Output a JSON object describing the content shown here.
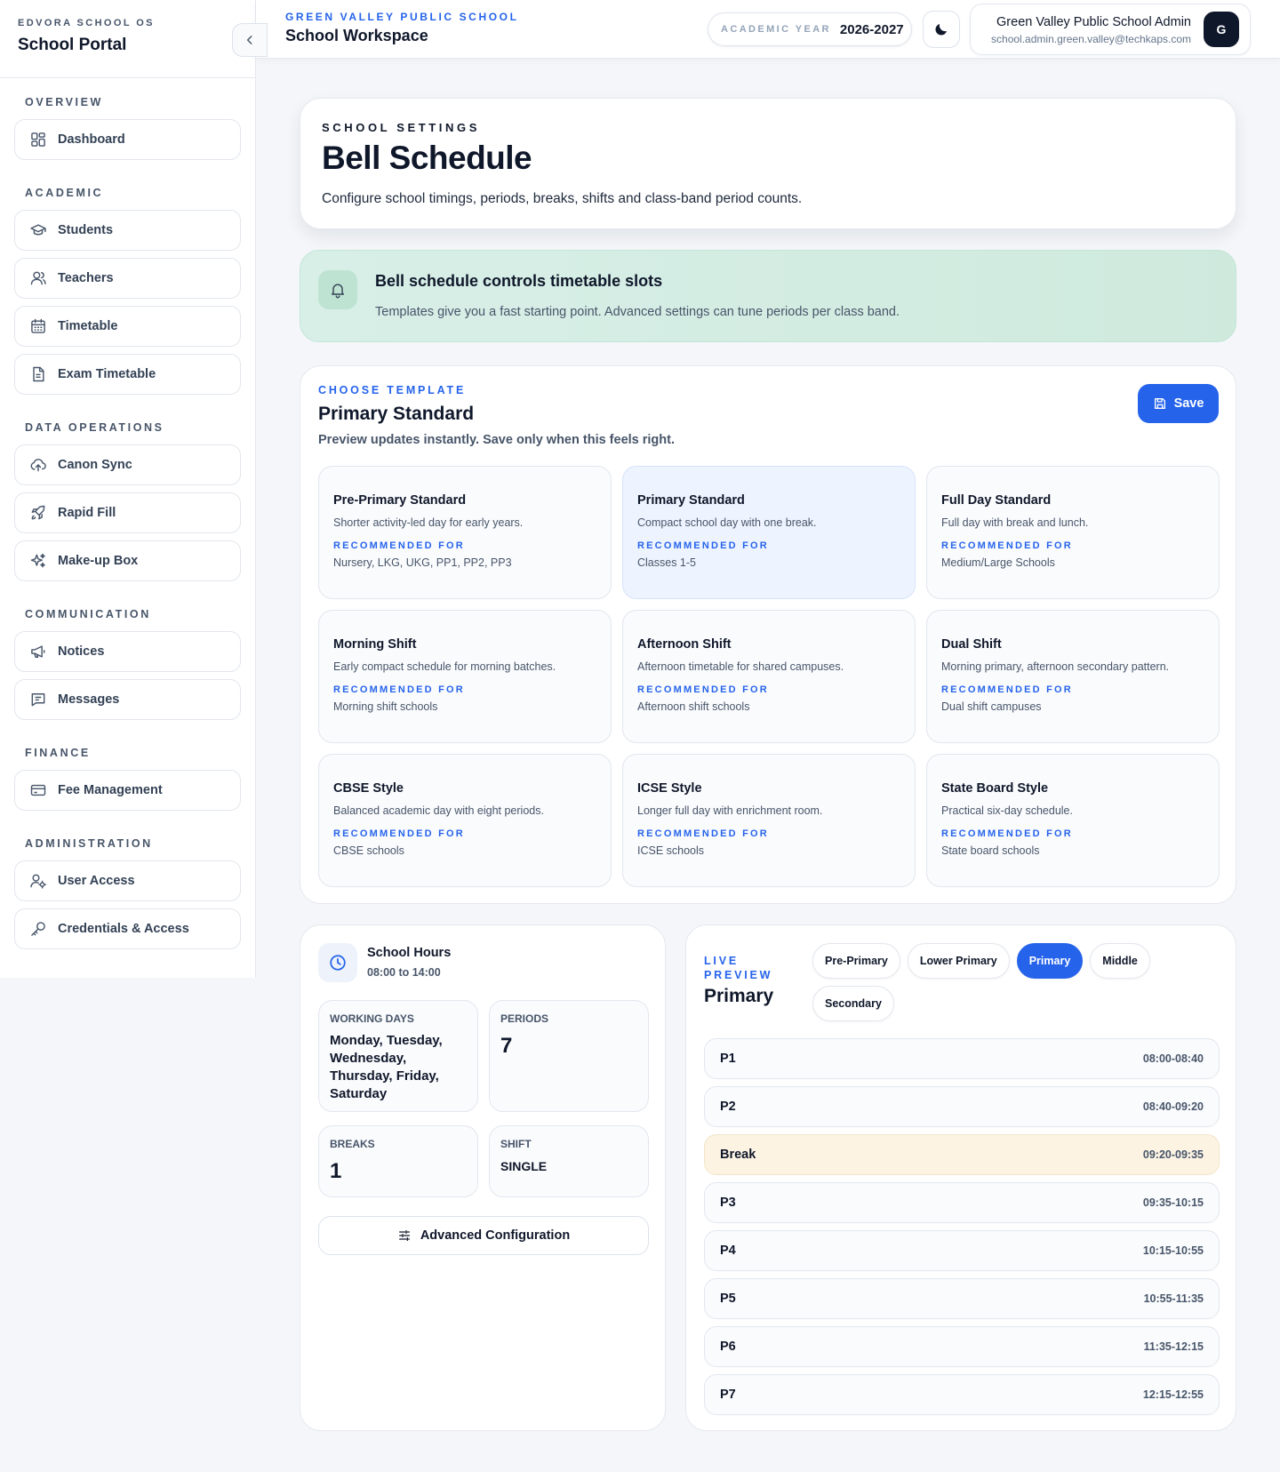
{
  "sidebar": {
    "kicker": "EDVORA SCHOOL OS",
    "title": "School Portal",
    "sections": [
      {
        "label": "OVERVIEW",
        "items": [
          {
            "label": "Dashboard",
            "icon": "dashboard-icon"
          }
        ]
      },
      {
        "label": "ACADEMIC",
        "items": [
          {
            "label": "Students",
            "icon": "graduation-cap-icon"
          },
          {
            "label": "Teachers",
            "icon": "users-icon"
          },
          {
            "label": "Timetable",
            "icon": "calendar-icon"
          },
          {
            "label": "Exam Timetable",
            "icon": "document-icon"
          }
        ]
      },
      {
        "label": "DATA OPERATIONS",
        "items": [
          {
            "label": "Canon Sync",
            "icon": "cloud-upload-icon"
          },
          {
            "label": "Rapid Fill",
            "icon": "rocket-icon"
          },
          {
            "label": "Make-up Box",
            "icon": "sparkles-icon"
          }
        ]
      },
      {
        "label": "COMMUNICATION",
        "items": [
          {
            "label": "Notices",
            "icon": "megaphone-icon"
          },
          {
            "label": "Messages",
            "icon": "message-icon"
          }
        ]
      },
      {
        "label": "FINANCE",
        "items": [
          {
            "label": "Fee Management",
            "icon": "card-icon"
          }
        ]
      },
      {
        "label": "ADMINISTRATION",
        "items": [
          {
            "label": "User Access",
            "icon": "user-gear-icon"
          },
          {
            "label": "Credentials & Access",
            "icon": "key-icon"
          }
        ]
      }
    ]
  },
  "topbar": {
    "kicker": "GREEN VALLEY PUBLIC SCHOOL",
    "title": "School Workspace",
    "year_label": "ACADEMIC YEAR",
    "year_value": "2026-2027",
    "user_name": "Green Valley Public School Admin",
    "user_email": "school.admin.green.valley@techkaps.com",
    "avatar_letter": "G"
  },
  "header": {
    "kicker": "SCHOOL SETTINGS",
    "title": "Bell Schedule",
    "subtitle": "Configure school timings, periods, breaks, shifts and class-band period counts."
  },
  "banner": {
    "title": "Bell schedule controls timetable slots",
    "subtitle": "Templates give you a fast starting point. Advanced settings can tune periods per class band."
  },
  "templates": {
    "kicker": "CHOOSE TEMPLATE",
    "title": "Primary Standard",
    "subtitle": "Preview updates instantly. Save only when this feels right.",
    "save_label": "Save",
    "rec_label": "RECOMMENDED FOR",
    "selected_index": 1,
    "items": [
      {
        "name": "Pre-Primary Standard",
        "desc": "Shorter activity-led day for early years.",
        "for": "Nursery, LKG, UKG, PP1, PP2, PP3"
      },
      {
        "name": "Primary Standard",
        "desc": "Compact school day with one break.",
        "for": "Classes 1-5"
      },
      {
        "name": "Full Day Standard",
        "desc": "Full day with break and lunch.",
        "for": "Medium/Large Schools"
      },
      {
        "name": "Morning Shift",
        "desc": "Early compact schedule for morning batches.",
        "for": "Morning shift schools"
      },
      {
        "name": "Afternoon Shift",
        "desc": "Afternoon timetable for shared campuses.",
        "for": "Afternoon shift schools"
      },
      {
        "name": "Dual Shift",
        "desc": "Morning primary, afternoon secondary pattern.",
        "for": "Dual shift campuses"
      },
      {
        "name": "CBSE Style",
        "desc": "Balanced academic day with eight periods.",
        "for": "CBSE schools"
      },
      {
        "name": "ICSE Style",
        "desc": "Longer full day with enrichment room.",
        "for": "ICSE schools"
      },
      {
        "name": "State Board Style",
        "desc": "Practical six-day schedule.",
        "for": "State board schools"
      }
    ]
  },
  "hours": {
    "title": "School Hours",
    "range": "08:00 to 14:00",
    "working_days_label": "WORKING DAYS",
    "working_days_value": "Monday, Tuesday, Wednesday, Thursday, Friday, Saturday",
    "periods_label": "PERIODS",
    "periods_value": "7",
    "breaks_label": "BREAKS",
    "breaks_value": "1",
    "shift_label": "SHIFT",
    "shift_value": "SINGLE",
    "advanced_label": "Advanced Configuration"
  },
  "preview": {
    "kicker": "LIVE PREVIEW",
    "title": "Primary",
    "tabs": [
      "Pre-Primary",
      "Lower Primary",
      "Primary",
      "Middle",
      "Secondary"
    ],
    "active_tab": 2,
    "periods": [
      {
        "name": "P1",
        "time": "08:00-08:40",
        "break": false
      },
      {
        "name": "P2",
        "time": "08:40-09:20",
        "break": false
      },
      {
        "name": "Break",
        "time": "09:20-09:35",
        "break": true
      },
      {
        "name": "P3",
        "time": "09:35-10:15",
        "break": false
      },
      {
        "name": "P4",
        "time": "10:15-10:55",
        "break": false
      },
      {
        "name": "P5",
        "time": "10:55-11:35",
        "break": false
      },
      {
        "name": "P6",
        "time": "11:35-12:15",
        "break": false
      },
      {
        "name": "P7",
        "time": "12:15-12:55",
        "break": false
      }
    ]
  },
  "colors": {
    "accent": "#2563eb",
    "banner": "#d8efe8",
    "break": "#fcf3e3",
    "ink": "#0f172a"
  }
}
